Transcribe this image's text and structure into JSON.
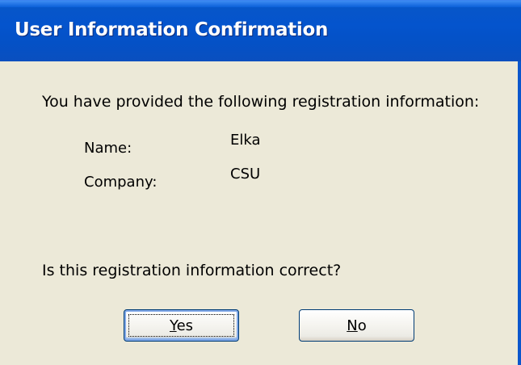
{
  "window": {
    "title": "User Information Confirmation"
  },
  "dialog": {
    "prompt": "You have provided the following registration information:",
    "fields": [
      {
        "label": "Name:",
        "value": "Elka"
      },
      {
        "label": "Company:",
        "value": "CSU"
      }
    ],
    "question": "Is this registration information correct?"
  },
  "buttons": {
    "yes": {
      "label": "Yes",
      "mnemonic": "Y",
      "rest": "es"
    },
    "no": {
      "label": "No",
      "mnemonic": "N",
      "rest": "o"
    }
  },
  "colors": {
    "titlebar": "#0454cd",
    "dialog_bg": "#ece9d8",
    "button_border": "#003c74"
  }
}
